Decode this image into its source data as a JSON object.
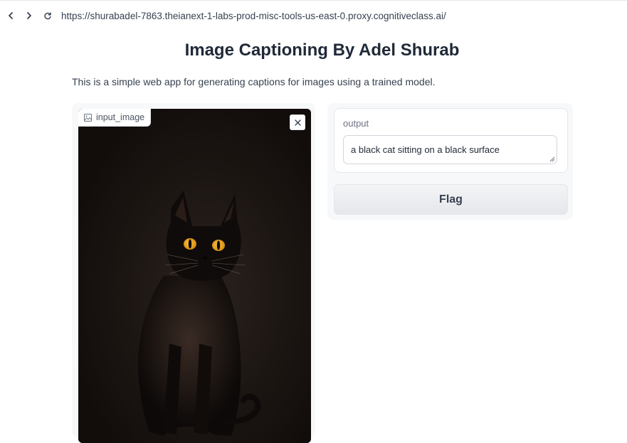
{
  "browser": {
    "url": "https://shurabadel-7863.theianext-1-labs-prod-misc-tools-us-east-0.proxy.cognitiveclass.ai/",
    "back_icon": "chevron-left",
    "forward_icon": "chevron-right",
    "reload_icon": "reload"
  },
  "app": {
    "title": "Image Captioning By Adel Shurab",
    "description": "This is a simple web app for generating captions for images using a trained model."
  },
  "input": {
    "label": "input_image",
    "label_icon": "image-icon",
    "clear_icon": "close-icon"
  },
  "output": {
    "label": "output",
    "value": "a black cat sitting on a black surface"
  },
  "actions": {
    "flag_label": "Flag"
  },
  "colors": {
    "panel_bg": "#f7f8fa",
    "image_bg": "#15100e",
    "cat_eye": "#e8a316"
  }
}
